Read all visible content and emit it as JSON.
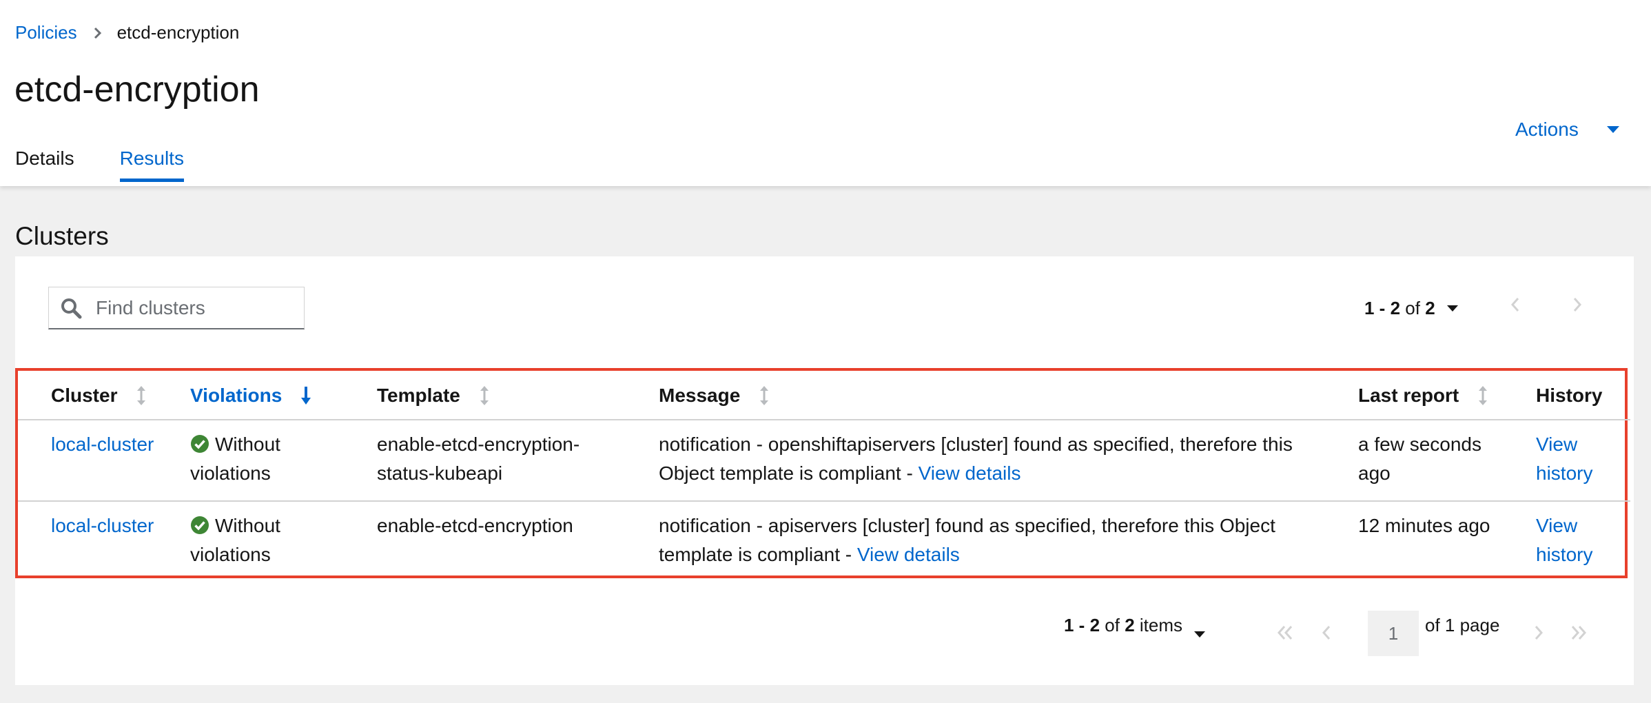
{
  "breadcrumb": {
    "parent": "Policies",
    "current": "etcd-encryption"
  },
  "page": {
    "title": "etcd-encryption"
  },
  "tabs": [
    {
      "label": "Details",
      "active": false
    },
    {
      "label": "Results",
      "active": true
    }
  ],
  "actions": {
    "label": "Actions"
  },
  "section": {
    "title": "Clusters"
  },
  "search": {
    "placeholder": "Find clusters",
    "value": ""
  },
  "pagination_top": {
    "range": "1 - 2",
    "of_label": "of",
    "total": "2"
  },
  "table": {
    "columns": [
      {
        "label": "Cluster",
        "sortable": true,
        "sorted": false
      },
      {
        "label": "Violations",
        "sortable": true,
        "sorted": true,
        "direction": "desc"
      },
      {
        "label": "Template",
        "sortable": true,
        "sorted": false
      },
      {
        "label": "Message",
        "sortable": true,
        "sorted": false
      },
      {
        "label": "Last report",
        "sortable": true,
        "sorted": false
      },
      {
        "label": "History",
        "sortable": false,
        "sorted": false
      }
    ],
    "rows": [
      {
        "cluster": "local-cluster",
        "violations_line1": "Without",
        "violations_line2": "violations",
        "template_line1": "enable-etcd-encryption-",
        "template_line2": "status-kubeapi",
        "message_line1": "notification - openshiftapiservers [cluster] found as specified, therefore this",
        "message_line2": "Object template is compliant - ",
        "message_link": "View details",
        "last_report_line1": "a few seconds",
        "last_report_line2": "ago",
        "history_line1": "View",
        "history_line2": "history"
      },
      {
        "cluster": "local-cluster",
        "violations_line1": "Without",
        "violations_line2": "violations",
        "template_line1": "enable-etcd-encryption",
        "template_line2": "",
        "message_line1": "notification - apiservers [cluster] found as specified, therefore this Object",
        "message_line2": "template is compliant - ",
        "message_link": "View details",
        "last_report_line1": "12 minutes ago",
        "last_report_line2": "",
        "history_line1": "View",
        "history_line2": "history"
      }
    ]
  },
  "pagination_bottom": {
    "range": "1 - 2",
    "of_label": "of",
    "total": "2",
    "items_label": "items",
    "page_value": "1",
    "of_pages": "of 1 page"
  },
  "colors": {
    "link": "#0066cc",
    "success": "#3e8635",
    "highlight_border": "#e8402c",
    "background": "#f0f0f0"
  }
}
